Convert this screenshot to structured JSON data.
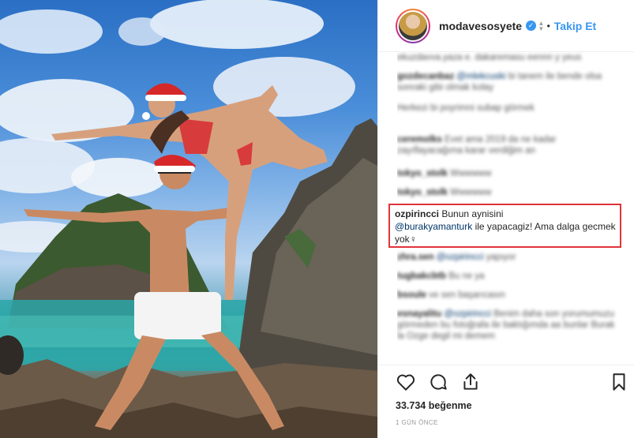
{
  "post": {
    "username": "modavesosyete",
    "verified_mark": "✓",
    "follow_dot": "•",
    "follow_label": "Takip Et",
    "avatar_icon": "avatar",
    "likes": "33.734 beğenme",
    "time": "1 GÜN ÖNCE"
  },
  "comments": [
    {
      "user": "",
      "text": "ekuzdavva.yaza e. dakaremasu eennn y yeus"
    },
    {
      "user": "gozdecanbaz",
      "mention": "@mlekcuski",
      "text": "bi tanem ile bende olsa sonraki gibi olmak kolay"
    },
    {
      "user": "",
      "text": "Herkezi bi poyrimni subap görmek"
    },
    {
      "user": "ceremolks",
      "text": "Evet ama 2019 da ne kadar zayıflayacağıma karar verdiğim an"
    },
    {
      "user": "tokyo_stolk",
      "text": "Wwwwww"
    },
    {
      "user": "tokyo_stolk",
      "text": "Wwwwww"
    },
    {
      "user": "zhra.sen",
      "mention": "@ozpirincci",
      "text": "yapıyor"
    },
    {
      "user": "tugbakcbtb",
      "text": "Bu ne ya"
    },
    {
      "user": "bsoule",
      "text": "ve sen başarıcasın"
    },
    {
      "user": "esnayalitu",
      "mention": "@ozpirincci",
      "text": "Benim daha son yorumumuzu görmeden bu fotoğrafa ile baktığımda aa bunlar Burak la Ozge degil mi demem"
    }
  ],
  "highlighted_comment": {
    "user": "ozpirincci",
    "line1": "Bunun aynisini",
    "mention": "@burakyamanturk",
    "line2": "ile yapacagiz! Ama dalga gecmek yok",
    "trailing": "⁣⁣⁣‍♀"
  },
  "icons": [
    "heart-icon",
    "comment-icon",
    "share-icon",
    "bookmark-icon"
  ],
  "colors": {
    "accent": "#3897f0",
    "highlight_border": "#e0353b"
  }
}
